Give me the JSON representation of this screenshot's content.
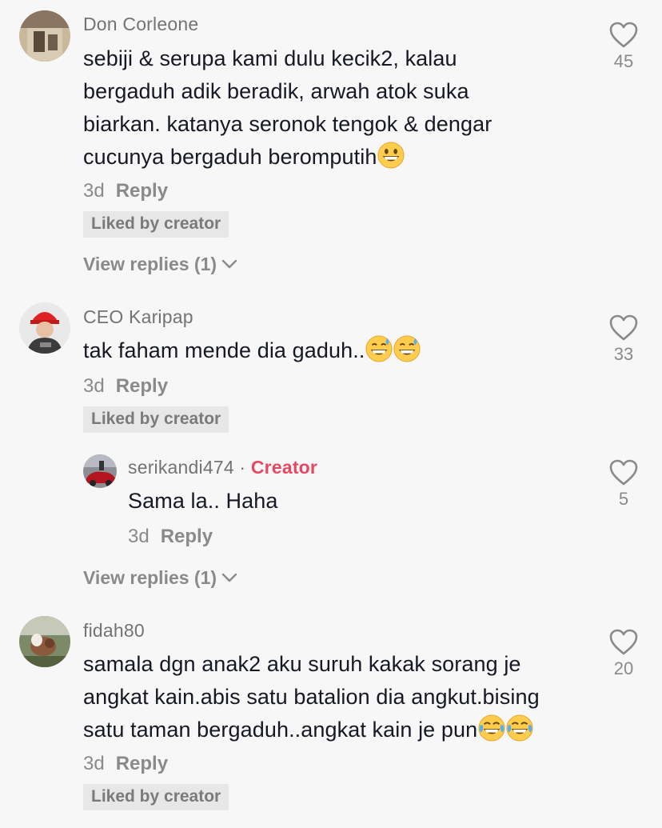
{
  "comments": [
    {
      "username": "Don Corleone",
      "text": "sebiji & serupa kami dulu kecik2, kalau bergaduh adik beradik, arwah atok suka biarkan. katanya seronok tengok & dengar cucunya bergaduh beromputih",
      "lines": [
        "sebiji & serupa kami dulu kecik2, kalau",
        "bergaduh adik beradik, arwah atok suka",
        "biarkan. katanya seronok tengok & dengar",
        "cucunya bergaduh beromputih"
      ],
      "emojis": [
        "grinning-emoji"
      ],
      "time": "3d",
      "reply_label": "Reply",
      "liked_by_creator": "Liked by creator",
      "view_replies": "View replies (1)",
      "likes": "45"
    },
    {
      "username": "CEO Karipap",
      "lines": [
        "tak faham mende dia gaduh.."
      ],
      "emojis": [
        "sweat-smile-emoji",
        "sweat-smile-emoji"
      ],
      "time": "3d",
      "reply_label": "Reply",
      "liked_by_creator": "Liked by creator",
      "likes": "33",
      "reply": {
        "username": "serikandi474",
        "separator": "·",
        "creator_label": "Creator",
        "text": "Sama la.. Haha",
        "time": "3d",
        "reply_label": "Reply",
        "likes": "5"
      },
      "view_replies": "View replies (1)"
    },
    {
      "username": "fidah80",
      "lines": [
        "samala dgn anak2 aku suruh kakak sorang je",
        "angkat kain.abis satu batalion dia angkut.bising",
        "satu taman bergaduh..angkat kain je pun"
      ],
      "emojis": [
        "joy-emoji",
        "joy-emoji"
      ],
      "time": "3d",
      "reply_label": "Reply",
      "liked_by_creator": "Liked by creator",
      "likes": "20"
    }
  ],
  "colors": {
    "background": "#f7f7f7",
    "text": "#161823",
    "muted": "#8a8a8a",
    "creator": "#e8485f",
    "chip": "#e7e7e7"
  }
}
